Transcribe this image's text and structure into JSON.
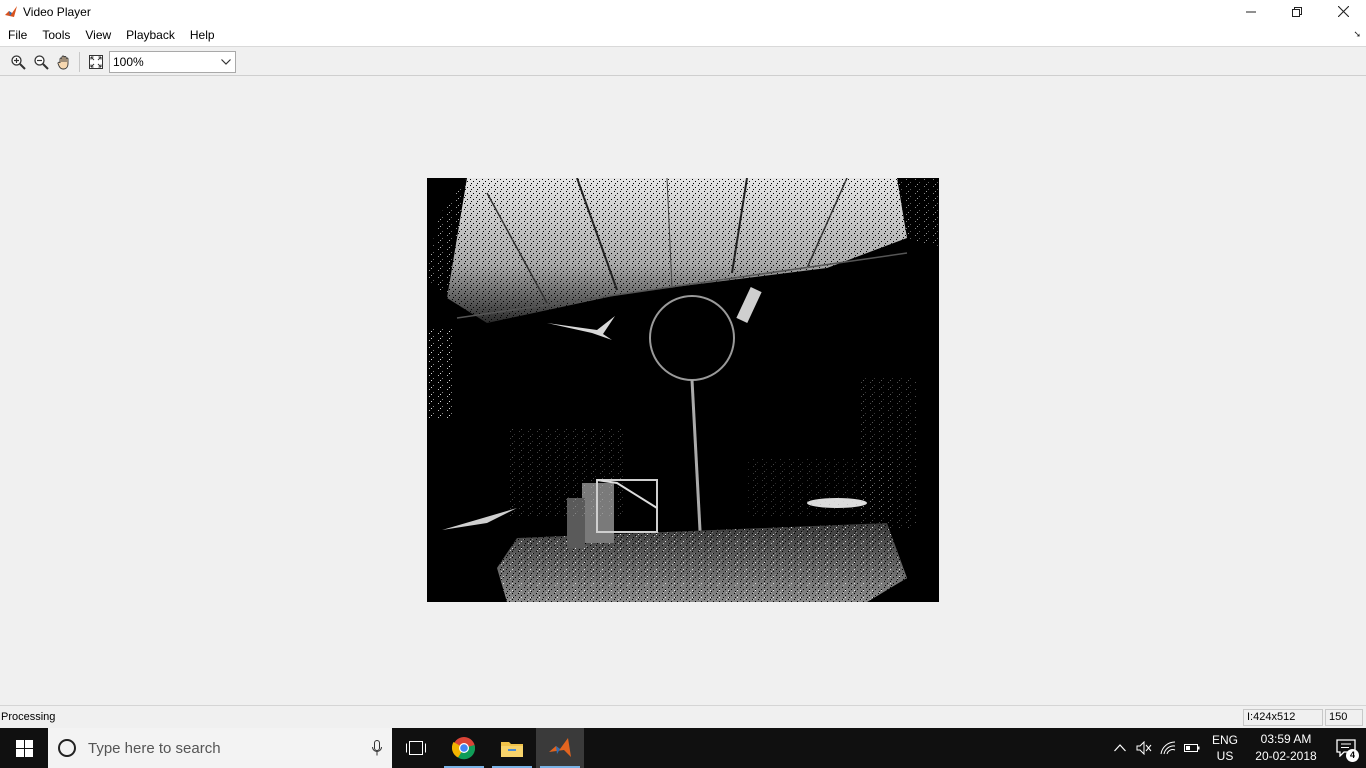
{
  "window": {
    "title": "Video Player"
  },
  "menu": {
    "items": [
      "File",
      "Tools",
      "View",
      "Playback",
      "Help"
    ]
  },
  "toolbar": {
    "zoom_in_icon": "zoom-in-icon",
    "zoom_out_icon": "zoom-out-icon",
    "pan_icon": "hand-pan-icon",
    "fit_icon": "fit-to-window-icon",
    "zoom_value": "100%"
  },
  "status": {
    "text": "Processing",
    "frame_info": "I:424x512",
    "frame_number": "150"
  },
  "taskbar": {
    "search_placeholder": "Type here to search",
    "apps": [
      "chrome",
      "file-explorer",
      "matlab"
    ],
    "language_top": "ENG",
    "language_bottom": "US",
    "time": "03:59 AM",
    "date": "20-02-2018",
    "notification_count": "4"
  },
  "colors": {
    "taskbar_bg": "#101010",
    "window_bg": "#f0f0f0",
    "active_underline": "#7ab3e6"
  }
}
